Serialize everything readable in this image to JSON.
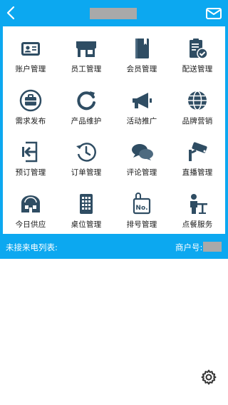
{
  "colors": {
    "accent": "#0ca8f0",
    "icon": "#2f4d63",
    "text": "#1a1a1a"
  },
  "header": {
    "back_icon": "chevron-left-icon",
    "mail_icon": "mail-icon"
  },
  "menu": [
    {
      "id": "account",
      "label": "账户管理",
      "icon": "id-card-icon"
    },
    {
      "id": "staff",
      "label": "员工管理",
      "icon": "store-icon"
    },
    {
      "id": "member",
      "label": "会员管理",
      "icon": "book-icon"
    },
    {
      "id": "delivery",
      "label": "配送管理",
      "icon": "clipboard-check-icon"
    },
    {
      "id": "demand",
      "label": "需求发布",
      "icon": "briefcase-icon"
    },
    {
      "id": "product",
      "label": "产品维护",
      "icon": "refresh-icon"
    },
    {
      "id": "promo",
      "label": "活动推广",
      "icon": "megaphone-icon"
    },
    {
      "id": "brand",
      "label": "品牌营销",
      "icon": "globe-icon"
    },
    {
      "id": "booking",
      "label": "预订管理",
      "icon": "door-enter-icon"
    },
    {
      "id": "order",
      "label": "订单管理",
      "icon": "history-icon"
    },
    {
      "id": "review",
      "label": "评论管理",
      "icon": "chat-bubbles-icon"
    },
    {
      "id": "live",
      "label": "直播管理",
      "icon": "camera-icon"
    },
    {
      "id": "supply",
      "label": "今日供应",
      "icon": "greenhouse-icon"
    },
    {
      "id": "table",
      "label": "桌位管理",
      "icon": "phone-grid-icon"
    },
    {
      "id": "queue",
      "label": "排号管理",
      "icon": "ticket-no-icon"
    },
    {
      "id": "dining",
      "label": "点餐服务",
      "icon": "waiter-icon"
    }
  ],
  "strip": {
    "left_label": "未接来电列表:",
    "right_label": "商户号:"
  },
  "footer": {
    "settings_icon": "gear-icon"
  }
}
